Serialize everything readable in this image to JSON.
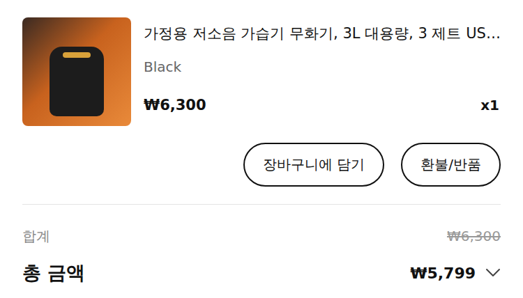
{
  "product": {
    "title": "가정용 저소음 가습기 무화기, 3L 대용량, 3 제트 US…",
    "option": "Black",
    "price": "₩6,300",
    "quantity": "x1"
  },
  "buttons": [
    "장바구니에 담기",
    "환불/반품"
  ],
  "summary": {
    "subtotal_label": "합계",
    "subtotal": "₩6,300",
    "total_label": "총 금액",
    "total": "₩5,799"
  }
}
